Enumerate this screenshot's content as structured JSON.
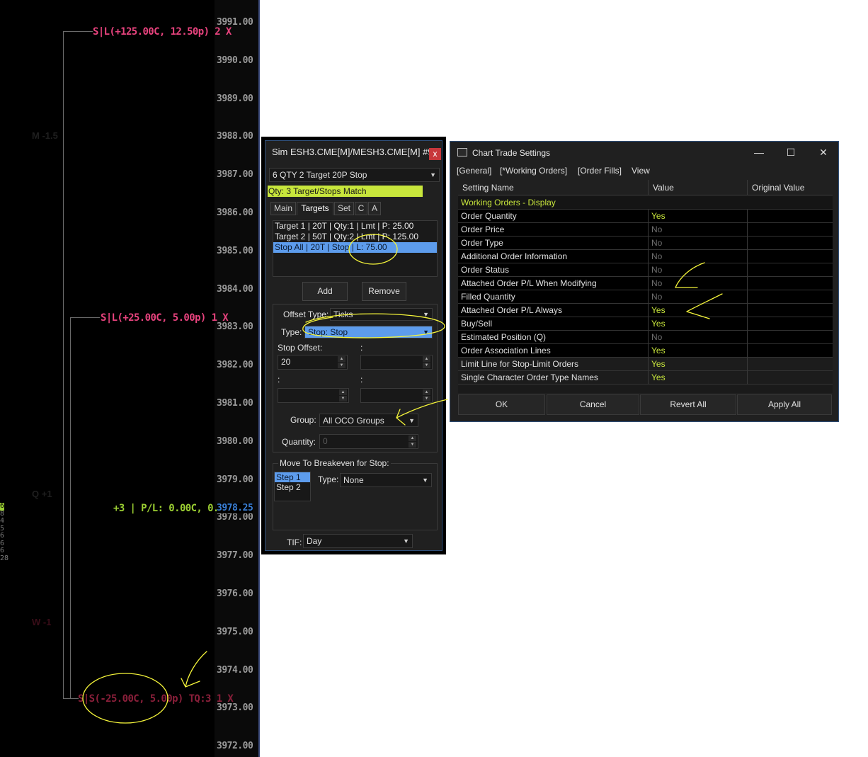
{
  "chart": {
    "prices": [
      "3991.00",
      "3990.00",
      "3989.00",
      "3988.00",
      "3987.00",
      "3986.00",
      "3985.00",
      "3984.00",
      "3983.00",
      "3982.00",
      "3981.00",
      "3980.00",
      "3979.00",
      "3978.00",
      "3977.00",
      "3976.00",
      "3975.00",
      "3974.00",
      "3973.00",
      "3972.00"
    ],
    "live_price": "3978.25",
    "orders": {
      "target2": "S|L(+125.00C, 12.50p)  2  X",
      "target1": "S|L(+25.00C, 5.00p)  1  X",
      "position": "+3 | P/L: 0.00C, 0.00p-",
      "stop": "S|S(-25.00C, 5.00p) TQ:3  1  X"
    },
    "dim_labels": {
      "m": "M -1.5",
      "q": "Q +1",
      "w": "W -1"
    },
    "left_numbers": [
      "6",
      "8",
      "4",
      "5",
      "6",
      "6",
      "6",
      "28"
    ],
    "colors": {
      "target": "#e8437e",
      "position": "#9acd32",
      "stop": "#8a1f3a",
      "live": "#3a7fd6"
    }
  },
  "order_panel": {
    "title": "Sim ESH3.CME[M]/MESH3.CME[M]  #9",
    "close": "x",
    "strategy": "6 QTY 2 Target 20P Stop",
    "qty_banner": "Qty: 3 Target/Stops Match",
    "tabs": [
      "Main",
      "Targets",
      "Set",
      "C",
      "A"
    ],
    "targets": [
      "Target 1 | 20T | Qty:1 | Lmt | P: 25.00",
      "Target 2 | 50T | Qty:2 | Lmt | P: 125.00",
      "Stop All | 20T | Stop | L: 75.00"
    ],
    "add": "Add",
    "remove": "Remove",
    "offset_type_label": "Offset Type:",
    "offset_type": "Ticks",
    "type_label": "Type:",
    "type_value": "Stop: Stop",
    "stop_offset_label": "Stop Offset:",
    "colon": ":",
    "stop_offset": "20",
    "group_label": "Group:",
    "group_value": "All OCO Groups",
    "quantity_label": "Quantity:",
    "quantity_value": "0",
    "breakeven_label": "Move To Breakeven for Stop:",
    "steps": [
      "Step 1",
      "Step 2"
    ],
    "be_type_label": "Type:",
    "be_type": "None",
    "tif_label": "TIF:",
    "tif": "Day"
  },
  "settings": {
    "title": "Chart Trade Settings",
    "window_buttons": [
      "—",
      "☐",
      "✕"
    ],
    "menu": [
      "[General]",
      "[*Working Orders]",
      "[Order Fills]",
      "View"
    ],
    "columns": [
      "Setting Name",
      "Value",
      "Original Value"
    ],
    "section": "Working Orders - Display",
    "rows": [
      {
        "name": "Order Quantity",
        "value": "Yes"
      },
      {
        "name": "Order Price",
        "value": "No"
      },
      {
        "name": "Order Type",
        "value": "No"
      },
      {
        "name": "Additional Order Information",
        "value": "No"
      },
      {
        "name": "Order Status",
        "value": "No"
      },
      {
        "name": "Attached Order P/L When Modifying",
        "value": "No"
      },
      {
        "name": "Filled Quantity",
        "value": "No"
      },
      {
        "name": "Attached Order P/L Always",
        "value": "Yes"
      },
      {
        "name": "Buy/Sell",
        "value": "Yes"
      },
      {
        "name": "Estimated Position (Q)",
        "value": "No"
      },
      {
        "name": "Order Association Lines",
        "value": "Yes"
      },
      {
        "name": "Limit Line for Stop-Limit Orders",
        "value": "Yes"
      },
      {
        "name": "Single Character Order Type Names",
        "value": "Yes"
      }
    ],
    "buttons": [
      "OK",
      "Cancel",
      "Revert All",
      "Apply All"
    ],
    "colors": {
      "yes": "#c8e63c",
      "no": "#6e6e6e",
      "section": "#c8e63c"
    }
  }
}
